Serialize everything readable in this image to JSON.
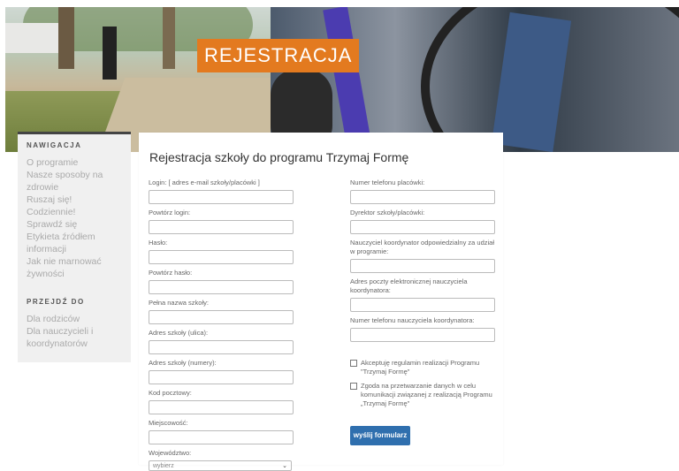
{
  "hero": {
    "badge": "REJESTRACJA"
  },
  "sidebar": {
    "nav_title": "NAWIGACJA",
    "nav_items": [
      "O programie",
      "Nasze sposoby na zdrowie",
      "Ruszaj się! Codziennie!",
      "Sprawdź się",
      "Etykieta źródłem informacji",
      "Jak nie marnować żywności"
    ],
    "goto_title": "PRZEJDŹ DO",
    "goto_items": [
      "Dla rodziców",
      "Dla nauczycieli i koordynatorów"
    ]
  },
  "form": {
    "title": "Rejestracja szkoły do programu Trzymaj Formę",
    "left": [
      "Login: [ adres e-mail szkoły/placówki ]",
      "Powtórz login:",
      "Hasło:",
      "Powtórz hasło:",
      "Pełna nazwa szkoły:",
      "Adres szkoły (ulica):",
      "Adres szkoły (numery):",
      "Kod pocztowy:",
      "Miejscowość:",
      "Województwo:"
    ],
    "select_value": "wybierz",
    "right": [
      "Numer telefonu placówki:",
      "Dyrektor szkoły/placówki:",
      "Nauczyciel koordynator odpowiedzialny za udział w programie:",
      "Adres poczty elektronicznej nauczyciela koordynatora:",
      "Numer telefonu nauczyciela koordynatora:"
    ],
    "consent1": "Akceptuję regulamin realizacji Programu \"Trzymaj Formę\"",
    "consent2": "Zgoda na przetwarzanie danych w celu komunikacji związanej z realizacją Programu „Trzymaj Formę\"",
    "submit": "wyślij formularz"
  },
  "colors": {
    "accent_orange": "#e37a1f",
    "button_blue": "#2f6fae"
  }
}
